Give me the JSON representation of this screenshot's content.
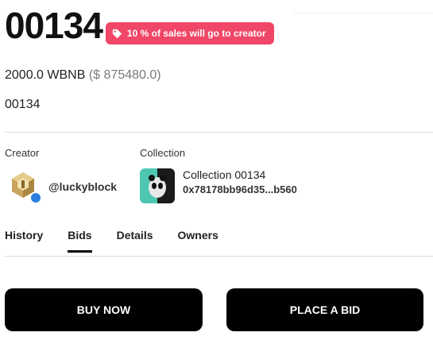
{
  "item": {
    "title": "00134",
    "badge_text": "10 % of sales will go to creator",
    "price": "2000.0 WBNB",
    "price_usd": "($ 875480.0)",
    "subname": "00134"
  },
  "creator": {
    "label": "Creator",
    "handle": "@luckyblock",
    "avatar_icon": "gold-block-icon",
    "verified_color": "#2b7fe0"
  },
  "collection": {
    "label": "Collection",
    "name": "Collection 00134",
    "address": "0x78178bb96d35...b560",
    "thumb_icon": "panda-art-thumbnail"
  },
  "tabs": [
    {
      "label": "History",
      "active": false
    },
    {
      "label": "Bids",
      "active": true
    },
    {
      "label": "Details",
      "active": false
    },
    {
      "label": "Owners",
      "active": false
    }
  ],
  "actions": {
    "buy_now": "BUY NOW",
    "place_bid": "PLACE A BID"
  },
  "colors": {
    "badge": "#f04667",
    "button": "#000000"
  }
}
